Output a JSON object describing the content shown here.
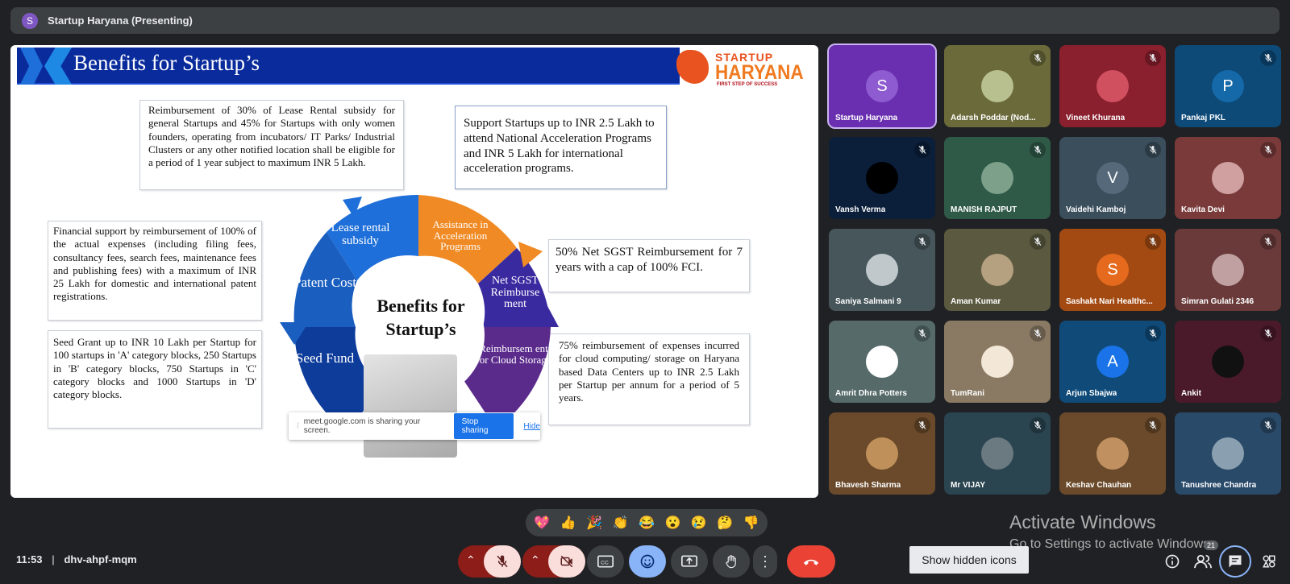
{
  "meeting": {
    "presenter_initial": "S",
    "presenter_title": "Startup Haryana (Presenting)",
    "time": "11:53",
    "code": "dhv-ahpf-mqm",
    "participant_count": "21"
  },
  "slide": {
    "title": "Benefits for Startup’s",
    "logo_top": "STARTUP",
    "logo_main": "HARYANA",
    "logo_tag": "FIRST STEP OF SUCCESS",
    "center_text_1": "Benefits for",
    "center_text_2": "Startup’s",
    "boxes": {
      "lease": "Reimbursement of 30% of Lease Rental subsidy for general Startups and 45% for Startups with only women founders, operating from incubators/ IT Parks/ Industrial Clusters or any other notified location shall be eligible for a period of 1 year subject to maximum INR 5 Lakh.",
      "acceleration": "Support Startups up to INR 2.5 Lakh to attend National Acceleration Programs and INR 5 Lakh for international acceleration programs.",
      "patent": "Financial support by reimbursement of 100% of the actual expenses (including filing fees, consultancy fees, search fees, maintenance fees and publishing fees) with a maximum of INR 25 Lakh for domestic and international patent registrations.",
      "seed": "Seed Grant up to INR 10 Lakh per Startup for 100 startups in 'A' category blocks, 250 Startups in 'B' category blocks, 750 Startups in 'C' category blocks and 1000 Startups in 'D' category blocks.",
      "sgst": "50% Net SGST Reimbursement for 7 years with a cap of 100% FCI.",
      "cloud": "75% reimbursement of expenses incurred for cloud computing/ storage on Haryana based Data Centers up to INR 2.5 Lakh per Startup per annum for a period of 5 years."
    },
    "segments": {
      "lease": "Lease rental subsidy",
      "assist": "Assistance in Acceleration Programs",
      "sgst": "Net SGST Reimburse ment",
      "cloud": "Reimbursem ent for Cloud Storage",
      "seed": "Seed Fund",
      "patent": "Patent Cost"
    }
  },
  "share_bar": {
    "message": "meet.google.com is sharing your screen.",
    "stop_label": "Stop sharing",
    "hide_label": "Hide"
  },
  "participants": [
    {
      "name": "Startup Haryana",
      "initial": "S",
      "bg": "#6a2fb0",
      "avatar_bg": "#8e5bd0",
      "mic": "none"
    },
    {
      "name": "Adarsh Poddar (Nod...",
      "initial": "",
      "bg": "#6b6a3a",
      "avatar_bg": "#b9c090",
      "mic": "muted"
    },
    {
      "name": "Vineet Khurana",
      "initial": "",
      "bg": "#8a1f2d",
      "avatar_bg": "#d05060",
      "mic": "muted"
    },
    {
      "name": "Pankaj PKL",
      "initial": "P",
      "bg": "#0d4a78",
      "avatar_bg": "#1669a8",
      "mic": "muted"
    },
    {
      "name": "Vansh Verma",
      "initial": "",
      "bg": "#0b1e3a",
      "avatar_bg": "#000000",
      "mic": "muted"
    },
    {
      "name": "MANISH RAJPUT",
      "initial": "",
      "bg": "#2f5a48",
      "avatar_bg": "#7da08a",
      "mic": "muted"
    },
    {
      "name": "Vaidehi Kamboj",
      "initial": "V",
      "bg": "#3a4e5c",
      "avatar_bg": "#55697a",
      "mic": "muted"
    },
    {
      "name": "Kavita Devi",
      "initial": "",
      "bg": "#7a3a3a",
      "avatar_bg": "#d0a0a0",
      "mic": "muted"
    },
    {
      "name": "Saniya Salmani 9",
      "initial": "",
      "bg": "#46565a",
      "avatar_bg": "#c0c8cc",
      "mic": "muted"
    },
    {
      "name": "Aman Kumar",
      "initial": "",
      "bg": "#5b5a40",
      "avatar_bg": "#b5a080",
      "mic": "muted"
    },
    {
      "name": "Sashakt Nari Healthc...",
      "initial": "S",
      "bg": "#a34a12",
      "avatar_bg": "#e56a1e",
      "mic": "muted"
    },
    {
      "name": "Simran Gulati 2346",
      "initial": "",
      "bg": "#6a3a3a",
      "avatar_bg": "#c0a0a0",
      "mic": "muted"
    },
    {
      "name": "Amrit Dhra Potters",
      "initial": "",
      "bg": "#566a6a",
      "avatar_bg": "#ffffff",
      "mic": "muted"
    },
    {
      "name": "TumRani",
      "initial": "",
      "bg": "#8a7a64",
      "avatar_bg": "#f3e8d8",
      "mic": "muted"
    },
    {
      "name": "Arjun Sbajwa",
      "initial": "A",
      "bg": "#0f4a78",
      "avatar_bg": "#1a73e8",
      "mic": "muted"
    },
    {
      "name": "Ankit",
      "initial": "",
      "bg": "#4a1a2a",
      "avatar_bg": "#111111",
      "mic": "muted"
    },
    {
      "name": "Bhavesh Sharma",
      "initial": "",
      "bg": "#6a4a2a",
      "avatar_bg": "#c0905a",
      "mic": "muted"
    },
    {
      "name": "Mr VIJAY",
      "initial": "",
      "bg": "#2a4450",
      "avatar_bg": "#6a7a80",
      "mic": "muted"
    },
    {
      "name": "Keshav Chauhan",
      "initial": "",
      "bg": "#6a4a2a",
      "avatar_bg": "#c09060",
      "mic": "muted"
    },
    {
      "name": "Tanushree Chandra",
      "initial": "",
      "bg": "#2a4a6a",
      "avatar_bg": "#8aa0b0",
      "mic": "muted"
    }
  ],
  "reactions": [
    "💖",
    "👍",
    "🎉",
    "👏",
    "😂",
    "😮",
    "😢",
    "🤔",
    "👎"
  ],
  "tooltip": "Show hidden icons",
  "watermark": {
    "line1": "Activate Windows",
    "line2": "Go to Settings to activate Windows."
  },
  "colors": {
    "end_call": "#ea4335",
    "control_dark": "#3c4043",
    "muted_red": "#f9dedc",
    "active_blue": "#8ab4f8"
  }
}
